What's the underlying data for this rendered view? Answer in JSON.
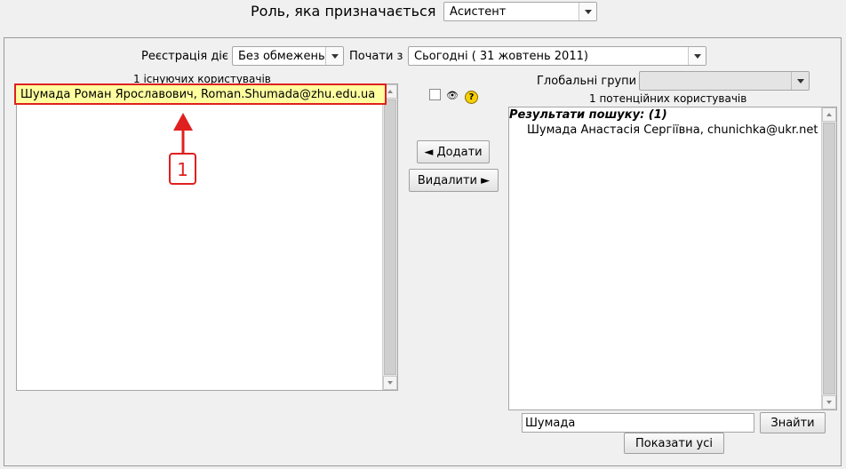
{
  "header": {
    "role_label": "Роль, яка призначається",
    "role_value": "Асистент"
  },
  "enrolment": {
    "duration_label": "Реєстрація діє",
    "duration_value": "Без обмежень",
    "start_label": "Почати з",
    "start_value": "Сьогодні ( 31 жовтень 2011)"
  },
  "existing": {
    "count_label": "1 існуючих користувачів",
    "users": [
      "Шумада Роман Ярославович, Roman.Shumada@zhu.edu.ua"
    ]
  },
  "actions": {
    "add_label": "◄ Додати",
    "remove_label": "Видалити ►",
    "help_glyph": "?",
    "eye_glyph": "👁"
  },
  "potential": {
    "groups_label": "Глобальні групи",
    "groups_value": "",
    "count_label": "1 потенційних користувачів",
    "results_header": "Результати пошуку: (1)",
    "users": [
      "Шумада Анастасія Сергіївна, chunichka@ukr.net"
    ]
  },
  "search": {
    "value": "Шумада",
    "find_label": "Знайти",
    "show_all_label": "Показати усі"
  },
  "annotation": {
    "marker_number": "1",
    "color": "#e02020",
    "fill": "#ffffff"
  },
  "colors": {
    "highlight": "#ffffa0",
    "annotation_red": "#e02020"
  }
}
